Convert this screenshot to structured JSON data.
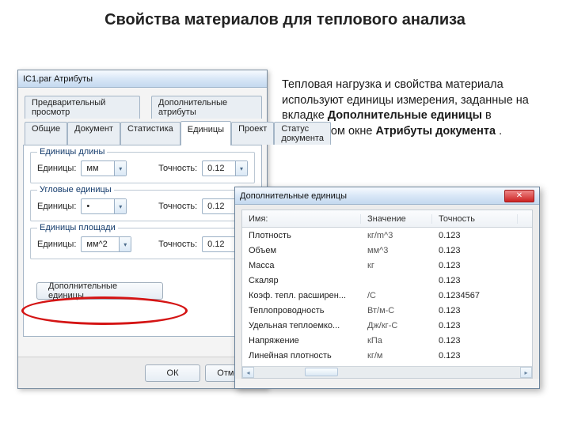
{
  "page_title": "Свойства материалов для теплового анализа",
  "side_paragraph": {
    "part1": "Тепловая нагрузка и свойства материала используют единицы измерения, заданные на вкладке ",
    "bold1": "Дополнительные единицы",
    "part2": " в диалоговом окне ",
    "bold2": "Атрибуты документа",
    "part3": "."
  },
  "dlg1": {
    "title": "IC1.par Атрибуты",
    "tab_row1": [
      "Предварительный просмотр",
      "Дополнительные атрибуты"
    ],
    "tab_row2": [
      "Общие",
      "Документ",
      "Статистика",
      "Единицы",
      "Проект",
      "Статус документа"
    ],
    "active_tab": "Единицы",
    "group1": {
      "caption": "Единицы длины",
      "units_label": "Единицы:",
      "units_value": "мм",
      "prec_label": "Точность:",
      "prec_value": "0.12"
    },
    "group2": {
      "caption": "Угловые единицы",
      "units_label": "Единицы:",
      "units_value": "•",
      "prec_label": "Точность:",
      "prec_value": "0.12"
    },
    "group3": {
      "caption": "Единицы площади",
      "units_label": "Единицы:",
      "units_value": "мм^2",
      "prec_label": "Точность:",
      "prec_value": "0.12"
    },
    "extra_units_btn": "Дополнительные единицы",
    "ok": "ОК",
    "cancel": "Отмена"
  },
  "dlg2": {
    "title": "Дополнительные единицы",
    "columns": {
      "name": "Имя:",
      "value": "Значение",
      "precision": "Точность"
    },
    "rows": [
      {
        "name": "Плотность",
        "value": "кг/m^3",
        "precision": "0.123"
      },
      {
        "name": "Объем",
        "value": "мм^3",
        "precision": "0.123"
      },
      {
        "name": "Масса",
        "value": "кг",
        "precision": "0.123"
      },
      {
        "name": "Скаляр",
        "value": "",
        "precision": "0.123"
      },
      {
        "name": "Коэф. тепл. расширен...",
        "value": "/C",
        "precision": "0.1234567"
      },
      {
        "name": "Теплопроводность",
        "value": "Вт/м-C",
        "precision": "0.123"
      },
      {
        "name": "Удельная теплоемко...",
        "value": "Дж/кг-C",
        "precision": "0.123"
      },
      {
        "name": "Напряжение",
        "value": "кПа",
        "precision": "0.123"
      },
      {
        "name": "Линейная плотность",
        "value": "кг/м",
        "precision": "0.123"
      }
    ]
  }
}
